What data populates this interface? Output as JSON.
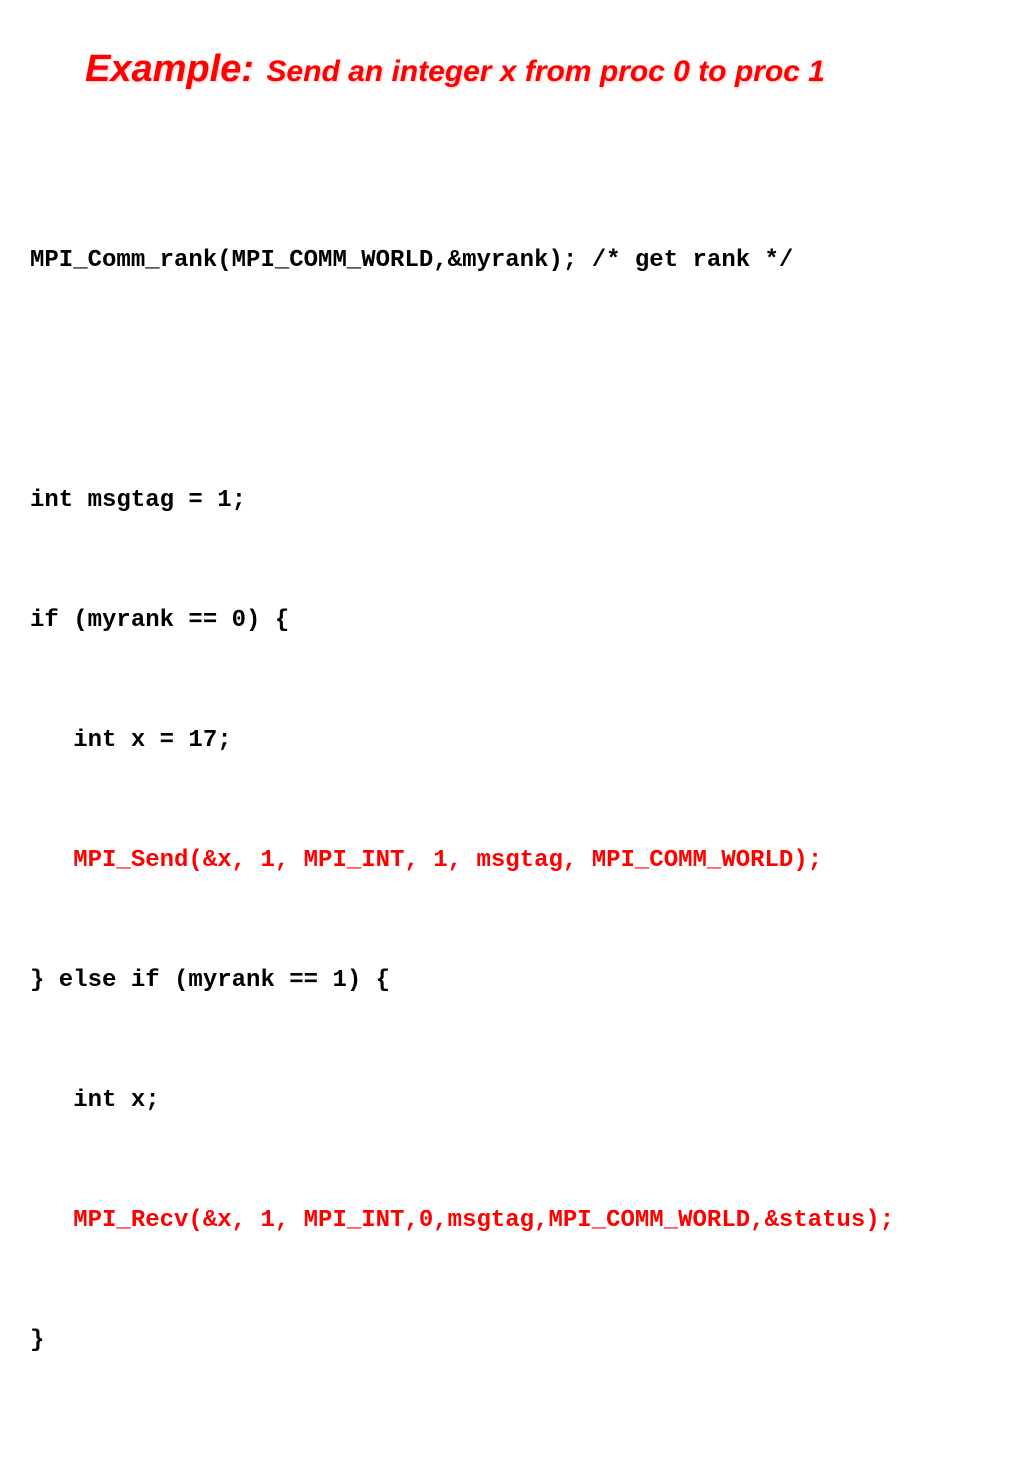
{
  "title": {
    "label": "Example:",
    "desc": "Send an integer x from proc 0 to proc 1"
  },
  "code": {
    "l1": "MPI_Comm_rank(MPI_COMM_WORLD,&myrank); /* get rank */",
    "l2": "int msgtag = 1;",
    "l3": "if (myrank == 0) {",
    "l4": "   int x = 17;",
    "l5": "   MPI_Send(&x, 1, MPI_INT, 1, msgtag, MPI_COMM_WORLD);",
    "l6": "} else if (myrank == 1) {",
    "l7": "   int x;",
    "l8": "   MPI_Recv(&x, 1, MPI_INT,0,msgtag,MPI_COMM_WORLD,&status);",
    "l9": "}"
  }
}
